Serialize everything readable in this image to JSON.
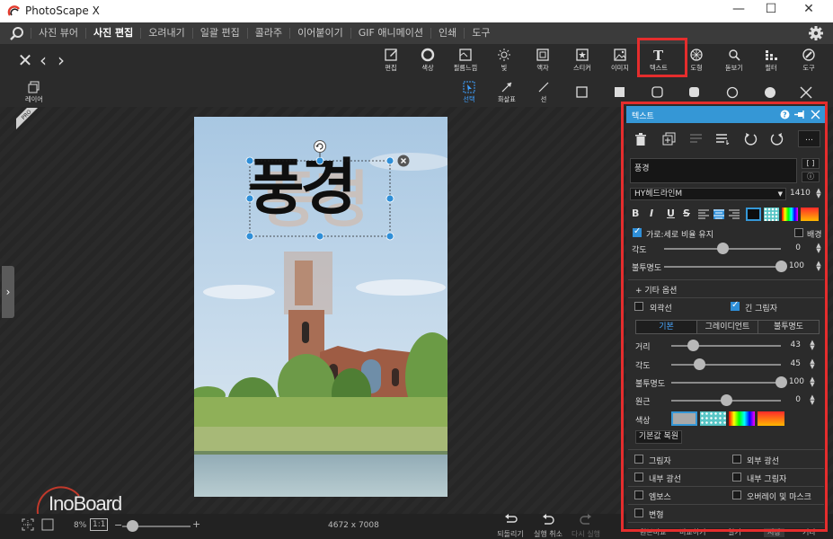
{
  "app": {
    "title": "PhotoScape X"
  },
  "window_controls": {
    "minimize": "—",
    "maximize": "☐",
    "close": "✕"
  },
  "menu": {
    "items": [
      "사진 뷰어",
      "사진 편집",
      "오려내기",
      "일괄 편집",
      "콜라주",
      "이어붙이기",
      "GIF 애니메이션",
      "인쇄",
      "도구"
    ],
    "active_index": 1
  },
  "toolbar": {
    "tools": [
      {
        "label": "편집",
        "icon": "edit-icon"
      },
      {
        "label": "색상",
        "icon": "color-circle-icon"
      },
      {
        "label": "필름느낌",
        "icon": "film-icon"
      },
      {
        "label": "빛",
        "icon": "sun-icon"
      },
      {
        "label": "액자",
        "icon": "frame-icon"
      },
      {
        "label": "스티커",
        "icon": "sticker-icon"
      },
      {
        "label": "이미지",
        "icon": "image-icon"
      },
      {
        "label": "텍스트",
        "icon": "text-icon"
      },
      {
        "label": "도형",
        "icon": "shape-icon"
      },
      {
        "label": "돋보기",
        "icon": "magnifier-icon"
      },
      {
        "label": "필터",
        "icon": "filter-icon"
      },
      {
        "label": "도구",
        "icon": "tools-icon"
      }
    ],
    "active_tool": "텍스트",
    "accent_color": "#e52d2d"
  },
  "subtoolbar": {
    "layer_label": "레이어",
    "select_label": "선택",
    "arrow_label": "화살표",
    "line_label": "선"
  },
  "canvas": {
    "text_object": "풍경",
    "image_size": "4672 x 7008"
  },
  "bottom": {
    "zoom": "8%",
    "one_to_one": "1:1",
    "minus": "−",
    "plus": "+",
    "image_size": "4672 x 7008",
    "undo_all": "되돌리기",
    "undo": "실행 취소",
    "redo": "다시 실행",
    "compare": "원본비교",
    "compare2": "비교하기",
    "open": "열기",
    "save": "저장",
    "more": "기타"
  },
  "watermark": "InoBoard",
  "panel": {
    "title": "텍스트",
    "text_value": "풍경",
    "font_name": "HY헤드라인M",
    "font_size": "1410",
    "keep_ratio_label": "가로:세로 비율 유지",
    "keep_ratio_checked": true,
    "background_label": "배경",
    "angle_label": "각도",
    "angle_value": "0",
    "angle_pos": 0.5,
    "opacity_label": "불투명도",
    "opacity_value": "100",
    "opacity_pos": 1.0,
    "more_options": "+ 기타 옵션",
    "outline_label": "외곽선",
    "long_shadow_label": "긴 그림자",
    "long_shadow_checked": true,
    "tabs": [
      "기본",
      "그레이디언트",
      "불투명도"
    ],
    "active_tab": 0,
    "distance_label": "거리",
    "distance_value": "43",
    "distance_pos": 0.2,
    "shadow_angle_label": "각도",
    "shadow_angle_value": "45",
    "shadow_angle_pos": 0.25,
    "shadow_opacity_label": "불투명도",
    "shadow_opacity_value": "100",
    "shadow_opacity_pos": 1.0,
    "perspective_label": "원근",
    "perspective_value": "0",
    "perspective_pos": 0.5,
    "color_label": "색상",
    "reset_label": "기본값 복원",
    "effects": [
      [
        "그림자",
        "외부 광선"
      ],
      [
        "내부 광선",
        "내부 그림자"
      ],
      [
        "엠보스",
        "오버레이 및 마스크"
      ],
      [
        "변형",
        ""
      ]
    ],
    "colors": {
      "header": "#3597d6",
      "swatch_gray": "#a9a9a9",
      "swatch_cyan": "#58c6c6"
    }
  }
}
